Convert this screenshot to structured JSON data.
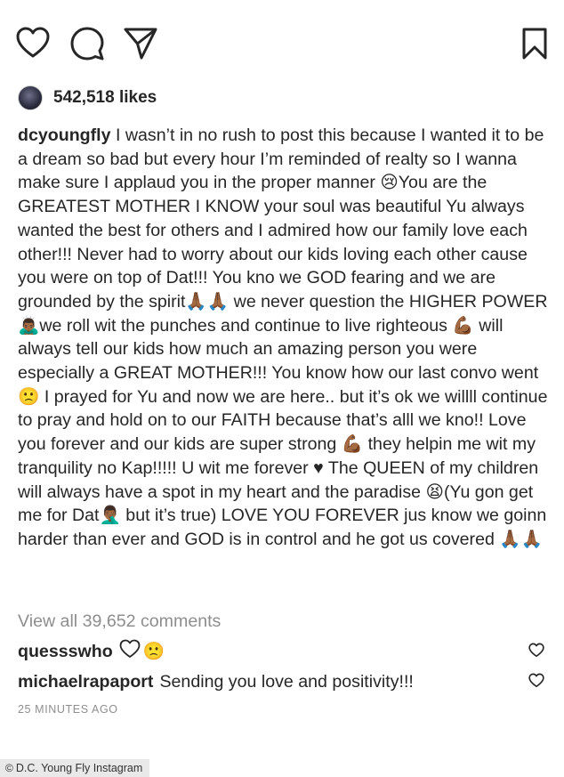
{
  "likes": "542,518 likes",
  "caption": {
    "username": "dcyoungfly",
    "text": " I wasn’t in no rush to post this because I wanted it to be a dream so bad but every hour I’m reminded of realty so I wanna make sure I applaud you in the proper manner 😢You are the GREATEST MOTHER I KNOW your soul was beautiful Yu always wanted the best for others and I admired how our family love each other!!! Never had to worry about our kids loving each other cause you were on top of Dat!!! You kno we GOD fearing and we are grounded by the spirit🙏🏾🙏🏾 we never question the HIGHER POWER 🙇🏾‍♂️we roll wit the punches and continue to live righteous 💪🏾 will always tell our kids how much an amazing person you were especially a GREAT MOTHER!!! You know how our last convo went 🙁 I prayed for Yu and now we are here.. but it’s ok we willll continue to pray and hold on to our FAITH because that’s alll we kno!! Love you forever and our kids are super strong 💪🏾 they helpin me wit my tranquility no Kap!!!!! U wit me forever ♥ The QUEEN of my children will always have a spot in my heart and the paradise 😫(Yu gon get me for Dat🤦🏾‍♂️ but it’s true) LOVE YOU FOREVER jus know we goinn harder than ever and GOD is in control and he got us covered 🙏🏾🙏🏾"
  },
  "view_all_comments": "View all 39,652 comments",
  "comments": [
    {
      "username": "quessswho",
      "text": "🙁"
    },
    {
      "username": "michaelrapaport",
      "text": "Sending you love and positivity!!!"
    }
  ],
  "timestamp": "25 MINUTES AGO",
  "credit": "D.C. Young Fly Instagram",
  "credit_symbol": "©",
  "icons": {
    "like": "heart-icon",
    "comment": "comment-bubble-icon",
    "share": "paper-plane-icon",
    "save": "bookmark-icon"
  }
}
